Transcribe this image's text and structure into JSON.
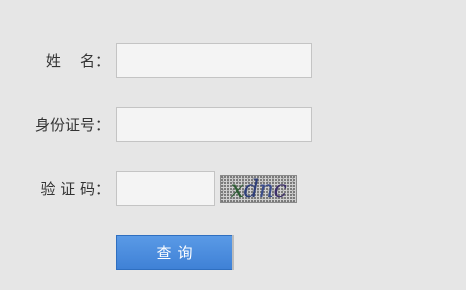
{
  "form": {
    "name_label": "姓    名：",
    "name_value": "",
    "id_label": "身份证号：",
    "id_value": "",
    "captcha_label": "验 证 码：",
    "captcha_value": "",
    "captcha_chars": [
      "x",
      "d",
      "n",
      "c"
    ],
    "query_button_label": "查询"
  }
}
